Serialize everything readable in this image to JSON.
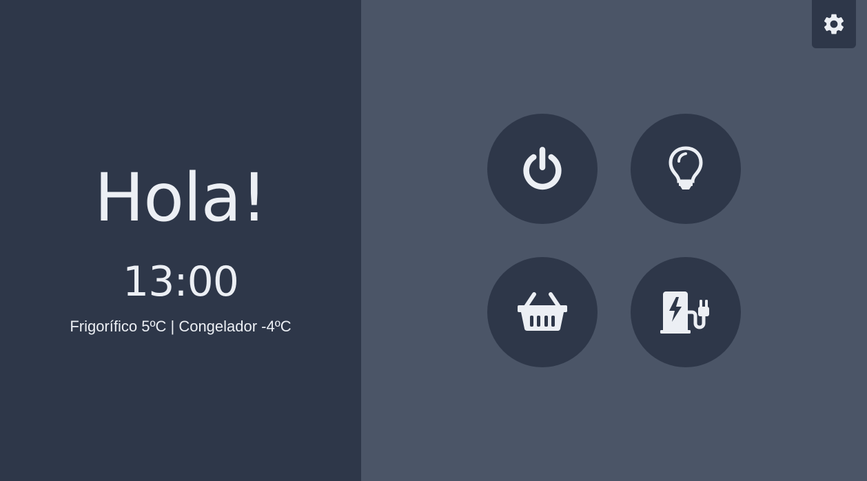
{
  "greeting": "Hola!",
  "clock": "13:00",
  "fridge_status": "Frigorífico 5ºC | Congelador -4ºC",
  "icons": {
    "settings": "gear-icon",
    "power": "power-icon",
    "light": "lightbulb-icon",
    "shopping": "basket-icon",
    "charger": "ev-charger-icon"
  },
  "colors": {
    "left_panel_bg": "#2e3749",
    "right_panel_bg": "#4b5567",
    "button_bg": "#2e3749",
    "foreground": "#eceff4"
  }
}
